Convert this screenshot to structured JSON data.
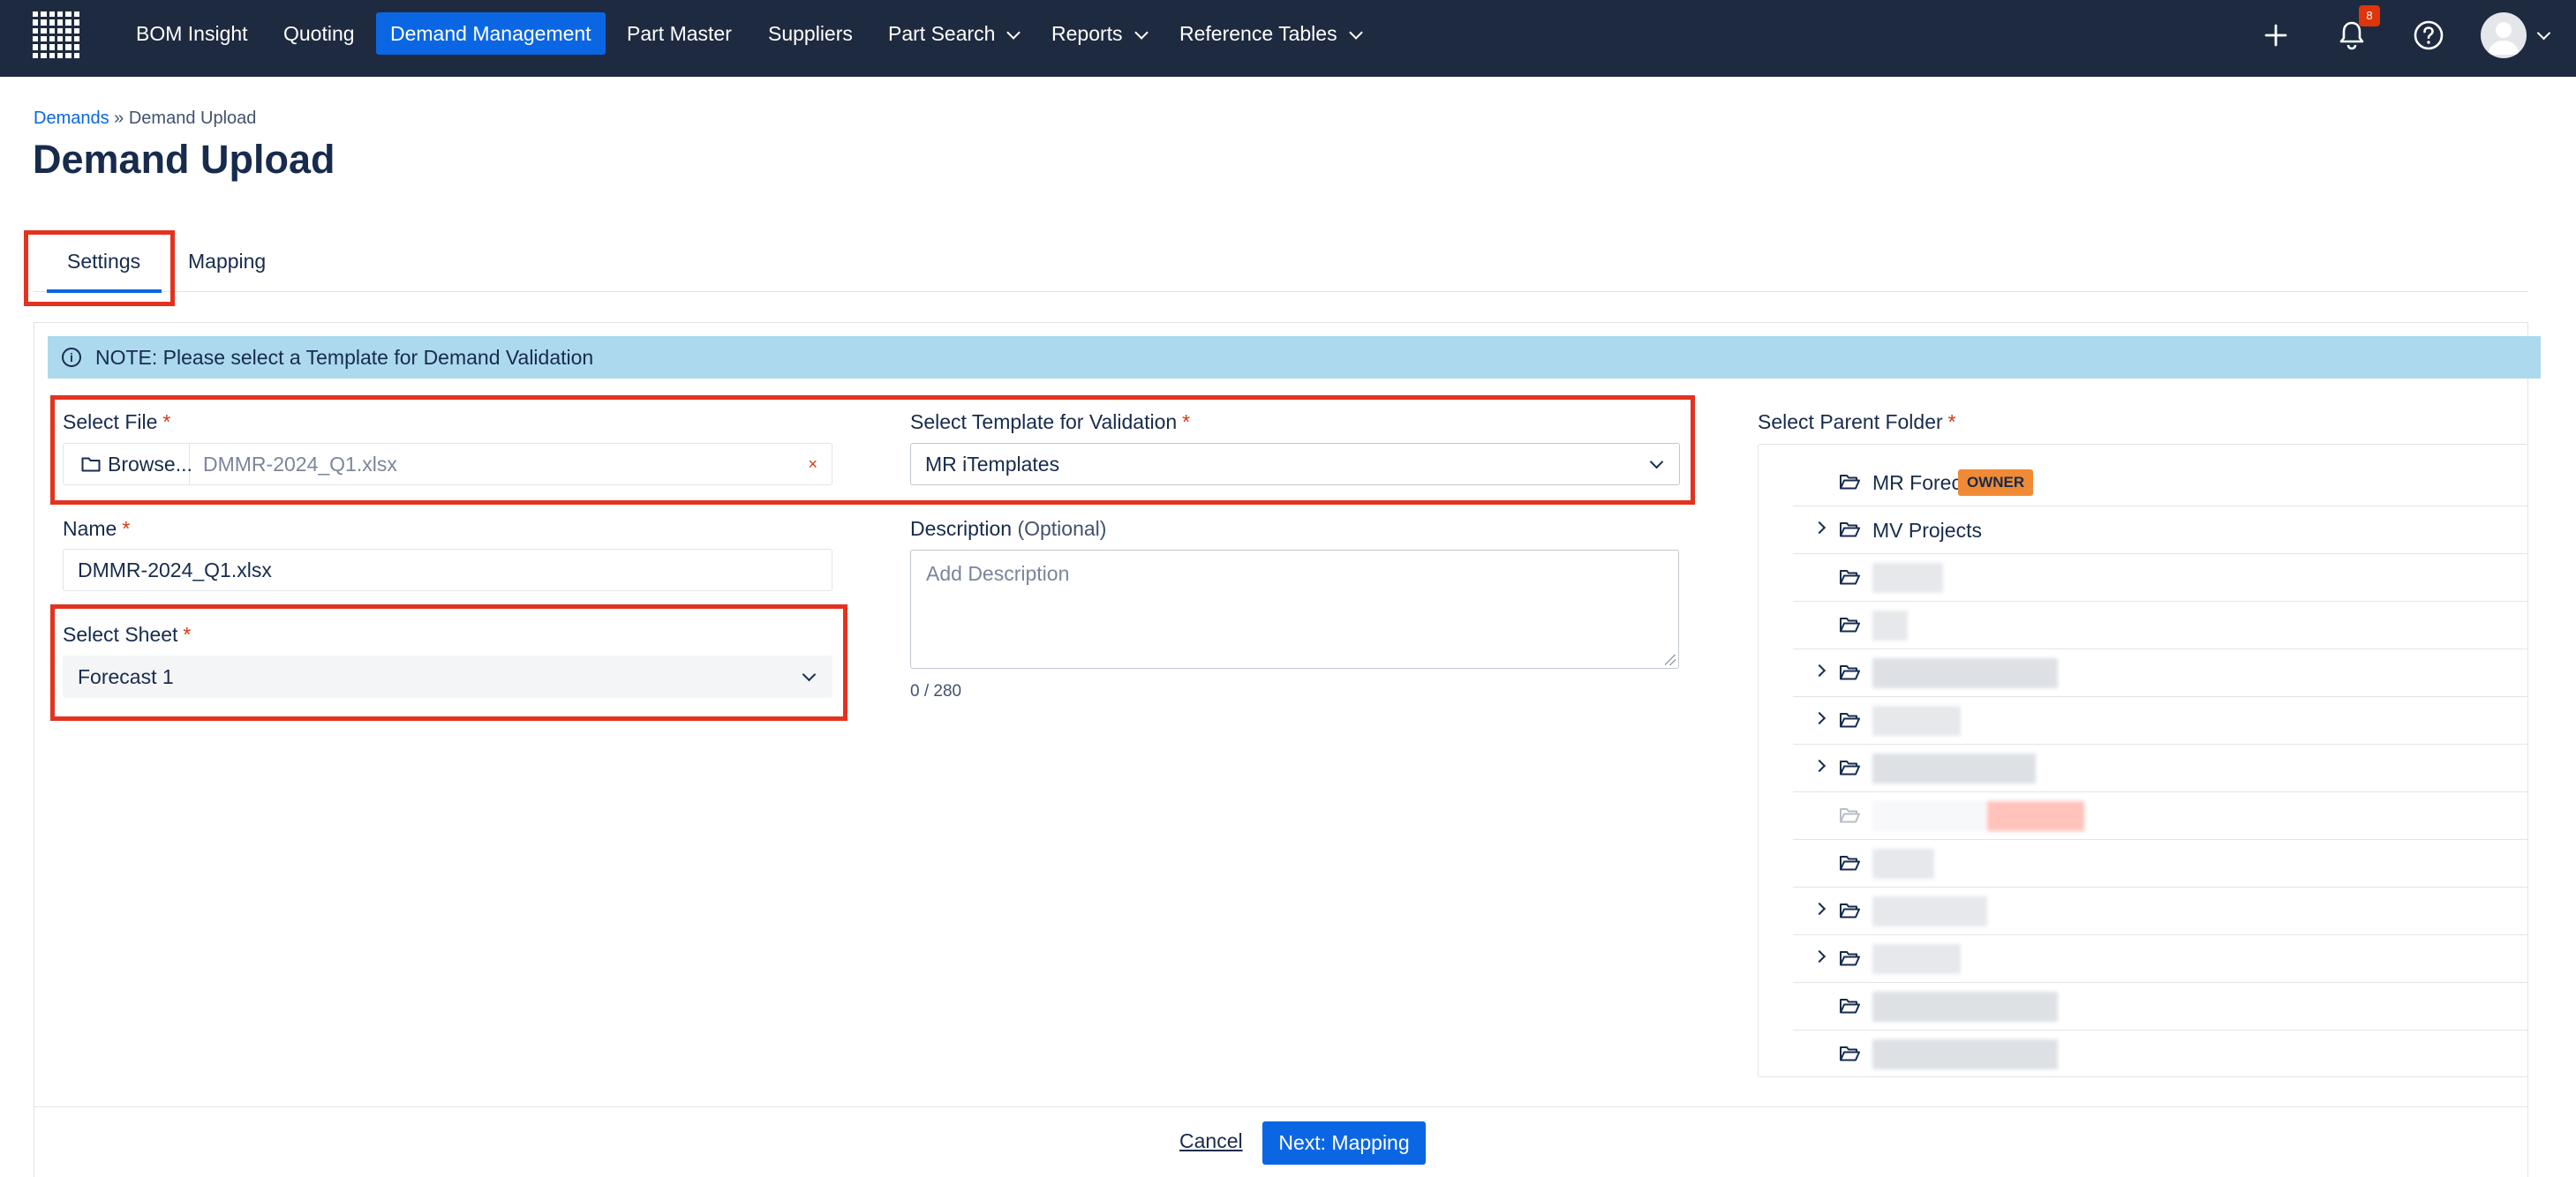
{
  "nav": {
    "items": [
      {
        "label": "BOM Insight"
      },
      {
        "label": "Quoting"
      },
      {
        "label": "Demand Management"
      },
      {
        "label": "Part Master"
      },
      {
        "label": "Suppliers"
      },
      {
        "label": "Part Search"
      },
      {
        "label": "Reports"
      },
      {
        "label": "Reference Tables"
      }
    ],
    "notification_count": "8"
  },
  "breadcrumb": {
    "parent": "Demands",
    "separator": "»",
    "current": "Demand Upload"
  },
  "page_title": "Demand Upload",
  "tabs": [
    {
      "label": "Settings"
    },
    {
      "label": "Mapping"
    }
  ],
  "note": "NOTE: Please select a Template for Demand Validation",
  "form": {
    "select_file": {
      "label": "Select File",
      "browse_label": "Browse...",
      "file_name": "DMMR-2024_Q1.xlsx",
      "clear": "×"
    },
    "template": {
      "label": "Select Template for Validation",
      "value": "MR iTemplates"
    },
    "name": {
      "label": "Name",
      "value": "DMMR-2024_Q1.xlsx"
    },
    "description": {
      "label": "Description",
      "optional": "(Optional)",
      "placeholder": "Add Description",
      "counter": "0 / 280"
    },
    "sheet": {
      "label": "Select Sheet",
      "value": "Forecast 1"
    },
    "required_mark": "*"
  },
  "parent_folder": {
    "label": "Select Parent Folder",
    "folders": [
      {
        "name": "MR Forecasts",
        "badge": "OWNER"
      },
      {
        "name": "MV Projects"
      }
    ]
  },
  "footer": {
    "cancel": "Cancel",
    "next": "Next: Mapping"
  },
  "colors": {
    "nav_bg": "#1e2a3f",
    "accent": "#0b66e4",
    "highlight": "#e3321f",
    "note_bg": "#acd9ee",
    "owner_badge": "#f18a35"
  }
}
